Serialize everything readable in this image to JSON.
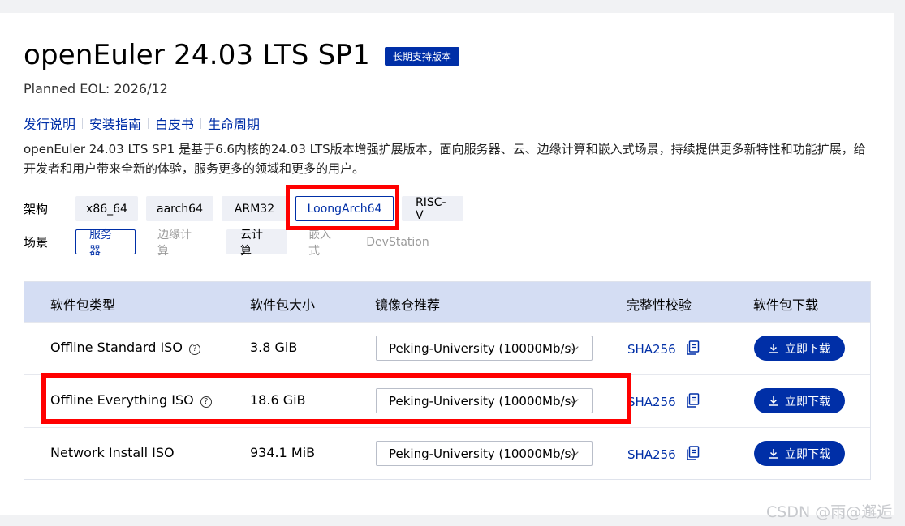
{
  "release": {
    "title": "openEuler 24.03 LTS SP1",
    "badge": "长期支持版本",
    "eol": "Planned EOL: 2026/12"
  },
  "links": [
    "发行说明",
    "安装指南",
    "白皮书",
    "生命周期"
  ],
  "description": "openEuler 24.03 LTS SP1 是基于6.6内核的24.03 LTS版本增强扩展版本，面向服务器、云、边缘计算和嵌入式场景，持续提供更多新特性和功能扩展，给开发者和用户带来全新的体验，服务更多的领域和更多的用户。",
  "architecture": {
    "label": "架构",
    "options": [
      "x86_64",
      "aarch64",
      "ARM32",
      "LoongArch64",
      "RISC-V"
    ],
    "selected": "LoongArch64"
  },
  "scenario": {
    "label": "场景",
    "options": [
      "服务器",
      "边缘计算",
      "云计算",
      "嵌入式",
      "DevStation"
    ],
    "selected": "服务器"
  },
  "table": {
    "headers": [
      "软件包类型",
      "软件包大小",
      "镜像仓推荐",
      "完整性校验",
      "软件包下载"
    ],
    "rows": [
      {
        "type": "Offline Standard ISO",
        "size": "3.8 GiB",
        "mirror": "Peking-University (10000Mb/s)",
        "checksum": "SHA256",
        "download": "立即下载"
      },
      {
        "type": "Offline Everything ISO",
        "size": "18.6 GiB",
        "mirror": "Peking-University (10000Mb/s)",
        "checksum": "SHA256",
        "download": "立即下载"
      },
      {
        "type": "Network Install ISO",
        "size": "934.1 MiB",
        "mirror": "Peking-University (10000Mb/s)",
        "checksum": "SHA256",
        "download": "立即下载"
      }
    ]
  },
  "watermark": "CSDN @雨@邂逅",
  "colors": {
    "accent": "#002fa7",
    "header_bg": "#d4ddf3",
    "highlight": "#ff0000"
  }
}
